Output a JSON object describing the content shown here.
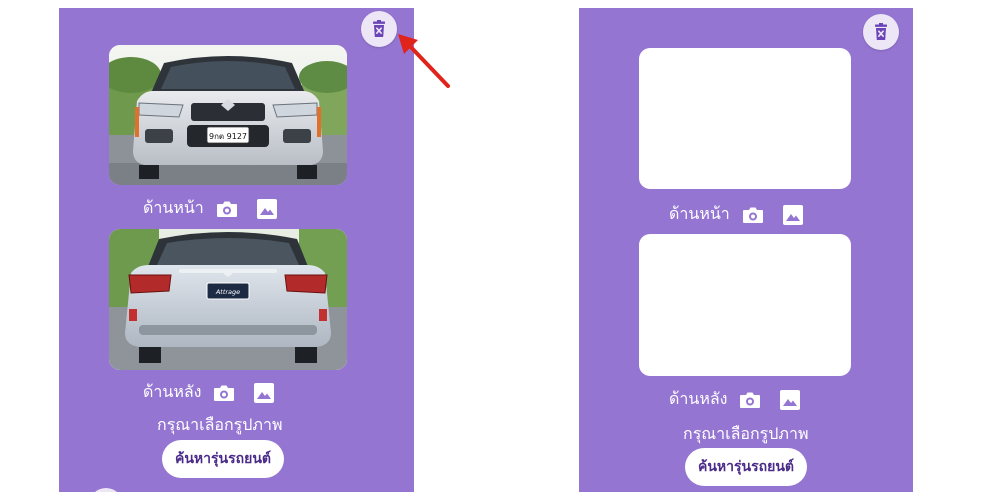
{
  "screens": {
    "left": {
      "front_label": "ด้านหน้า",
      "rear_label": "ด้านหลัง",
      "hint": "กรุณาเลือกรูปภาพ",
      "search_button": "ค้นหารุ่นรถยนต์",
      "front_plate_text": "9กต 9127",
      "rear_badge_text": "Attrage"
    },
    "right": {
      "front_label": "ด้านหน้า",
      "rear_label": "ด้านหลัง",
      "hint": "กรุณาเลือกรูปภาพ",
      "search_button": "ค้นหารุ่นรถยนต์"
    }
  },
  "icons": {
    "delete": "trash-x-icon",
    "camera": "camera-icon",
    "gallery": "image-icon",
    "annotation": "red-arrow-icon"
  },
  "colors": {
    "panel": "#9575d2",
    "button_text": "#4b2b89",
    "arrow": "#e0241b"
  }
}
